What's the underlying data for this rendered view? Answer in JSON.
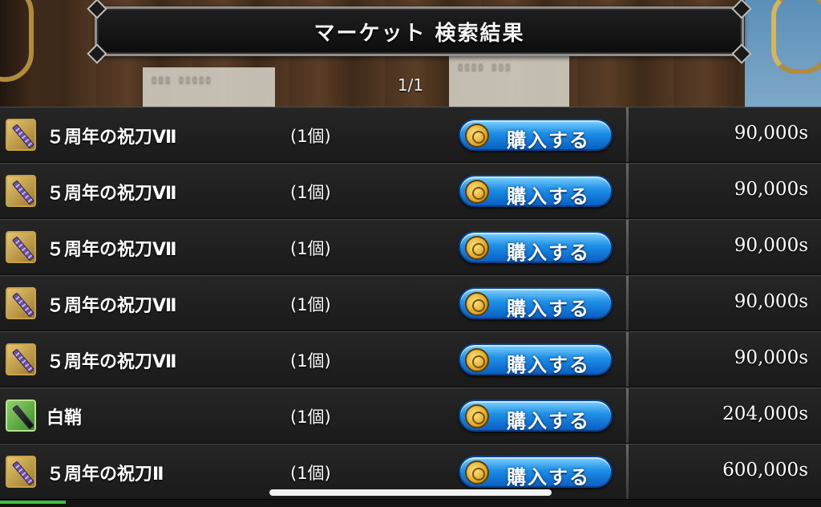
{
  "header": {
    "title": "マーケット 検索結果",
    "page": "1/1"
  },
  "rows": [
    {
      "name": "５周年の祝刀Ⅶ",
      "qty": "(1個)",
      "buy_label": "購入する",
      "price": "90,000s",
      "icon": "purple-sword-icon"
    },
    {
      "name": "５周年の祝刀Ⅶ",
      "qty": "(1個)",
      "buy_label": "購入する",
      "price": "90,000s",
      "icon": "purple-sword-icon"
    },
    {
      "name": "５周年の祝刀Ⅶ",
      "qty": "(1個)",
      "buy_label": "購入する",
      "price": "90,000s",
      "icon": "purple-sword-icon"
    },
    {
      "name": "５周年の祝刀Ⅶ",
      "qty": "(1個)",
      "buy_label": "購入する",
      "price": "90,000s",
      "icon": "purple-sword-icon"
    },
    {
      "name": "５周年の祝刀Ⅶ",
      "qty": "(1個)",
      "buy_label": "購入する",
      "price": "90,000s",
      "icon": "purple-sword-icon"
    },
    {
      "name": "白鞘",
      "qty": "(1個)",
      "buy_label": "購入する",
      "price": "204,000s",
      "icon": "green-sword-icon"
    },
    {
      "name": "５周年の祝刀Ⅱ",
      "qty": "(1個)",
      "buy_label": "購入する",
      "price": "600,000s",
      "icon": "purple-sword-icon"
    }
  ],
  "colors": {
    "button_blue": "#1d8fe6",
    "gold_frame": "#c9a14a",
    "green_frame": "#3c8a2b"
  }
}
